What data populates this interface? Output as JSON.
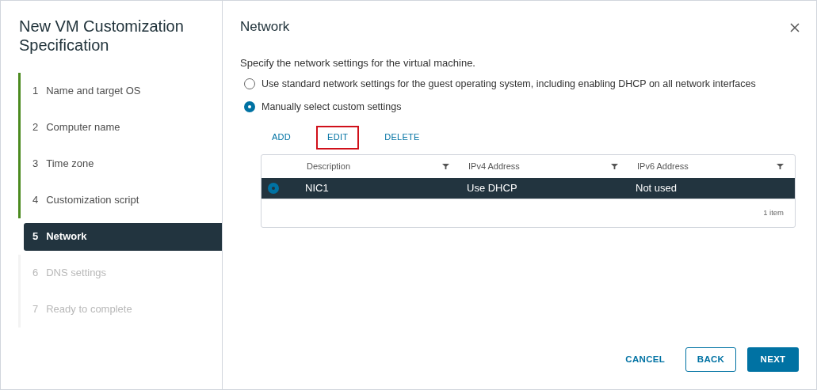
{
  "wizard": {
    "title": "New VM Customization Specification",
    "steps": [
      {
        "number": "1",
        "label": "Name and target OS",
        "completed": true,
        "disabled": false,
        "selected": false
      },
      {
        "number": "2",
        "label": "Computer name",
        "completed": true,
        "disabled": false,
        "selected": false
      },
      {
        "number": "3",
        "label": "Time zone",
        "completed": true,
        "disabled": false,
        "selected": false
      },
      {
        "number": "4",
        "label": "Customization script",
        "completed": true,
        "disabled": false,
        "selected": false
      },
      {
        "number": "5",
        "label": "Network",
        "completed": false,
        "disabled": false,
        "selected": true
      },
      {
        "number": "6",
        "label": "DNS settings",
        "completed": false,
        "disabled": true,
        "selected": false
      },
      {
        "number": "7",
        "label": "Ready to complete",
        "completed": false,
        "disabled": true,
        "selected": false
      }
    ]
  },
  "page": {
    "title": "Network",
    "description": "Specify the network settings for the virtual machine.",
    "options": [
      {
        "label": "Use standard network settings for the guest operating system, including enabling DHCP on all network interfaces",
        "selected": false
      },
      {
        "label": "Manually select custom settings",
        "selected": true
      }
    ],
    "toolbar": [
      {
        "label": "ADD",
        "highlighted": false
      },
      {
        "label": "EDIT",
        "highlighted": true
      },
      {
        "label": "DELETE",
        "highlighted": false
      }
    ],
    "table": {
      "columns": [
        "Description",
        "IPv4 Address",
        "IPv6 Address"
      ],
      "rows": [
        {
          "cells": [
            "NIC1",
            "Use DHCP",
            "Not used"
          ],
          "selected": true
        }
      ],
      "footer": "1 item"
    }
  },
  "buttons": [
    {
      "label": "CANCEL",
      "kind": "flat"
    },
    {
      "label": "BACK",
      "kind": "outline"
    },
    {
      "label": "NEXT",
      "kind": "primary"
    }
  ]
}
